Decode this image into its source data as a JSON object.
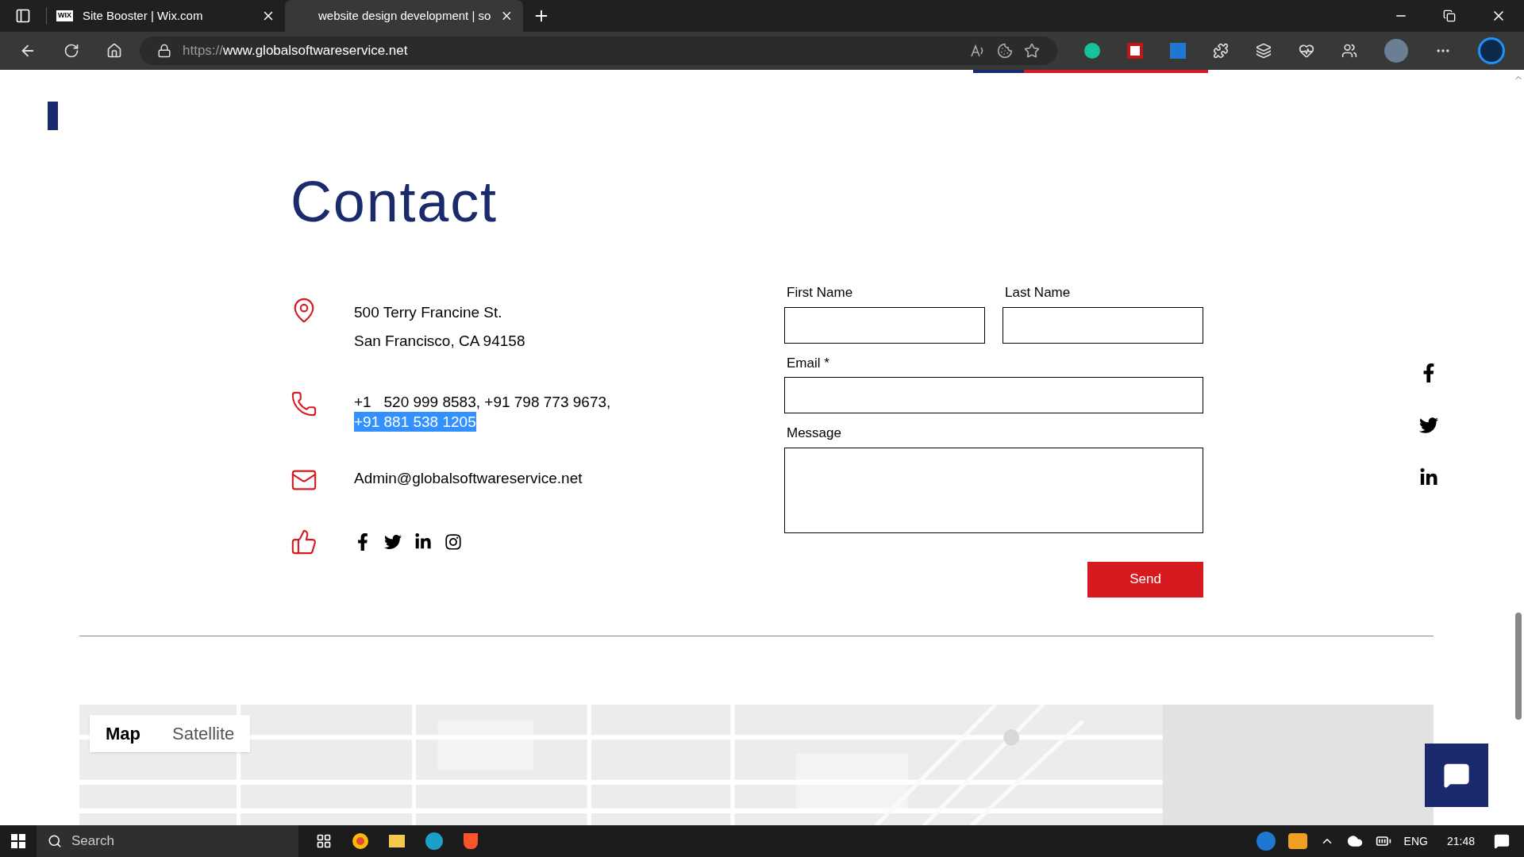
{
  "browser": {
    "tabs": [
      {
        "title": "Site Booster | Wix.com",
        "favicon": "WIX",
        "selected": false
      },
      {
        "title": "website design development | so",
        "selected": true
      }
    ],
    "url_scheme": "https://",
    "url_host": "www.globalsoftwareservice.net"
  },
  "page": {
    "heading": "Contact",
    "contact_items": [
      {
        "kind": "address",
        "lines": [
          "500 Terry Francine St.",
          "San Francisco, CA 94158"
        ]
      },
      {
        "kind": "phone",
        "lines": [
          "+1   520 999 8583, +91 798 773 9673,"
        ],
        "highlighted_line": "+91 881 538 1205"
      },
      {
        "kind": "email",
        "lines": [
          "Admin@globalsoftwareservice.net"
        ]
      },
      {
        "kind": "social",
        "links": [
          {
            "kind": "facebook"
          },
          {
            "kind": "twitter"
          },
          {
            "kind": "linkedin"
          },
          {
            "kind": "instagram"
          }
        ]
      }
    ],
    "side_social_links": [
      {
        "kind": "facebook"
      },
      {
        "kind": "twitter"
      },
      {
        "kind": "linkedin"
      }
    ],
    "form": {
      "fields": [
        {
          "label": "First Name",
          "kind": "input"
        },
        {
          "label": "Last Name",
          "kind": "input"
        },
        {
          "label": "Email *",
          "kind": "input"
        },
        {
          "label": "Message",
          "kind": "textarea"
        }
      ],
      "submit": "Send"
    },
    "map_buttons": [
      {
        "label": "Map",
        "selected": true
      },
      {
        "label": "Satellite",
        "selected": false
      }
    ]
  },
  "taskbar": {
    "search": "Search",
    "language": "ENG",
    "time": "21:48"
  }
}
